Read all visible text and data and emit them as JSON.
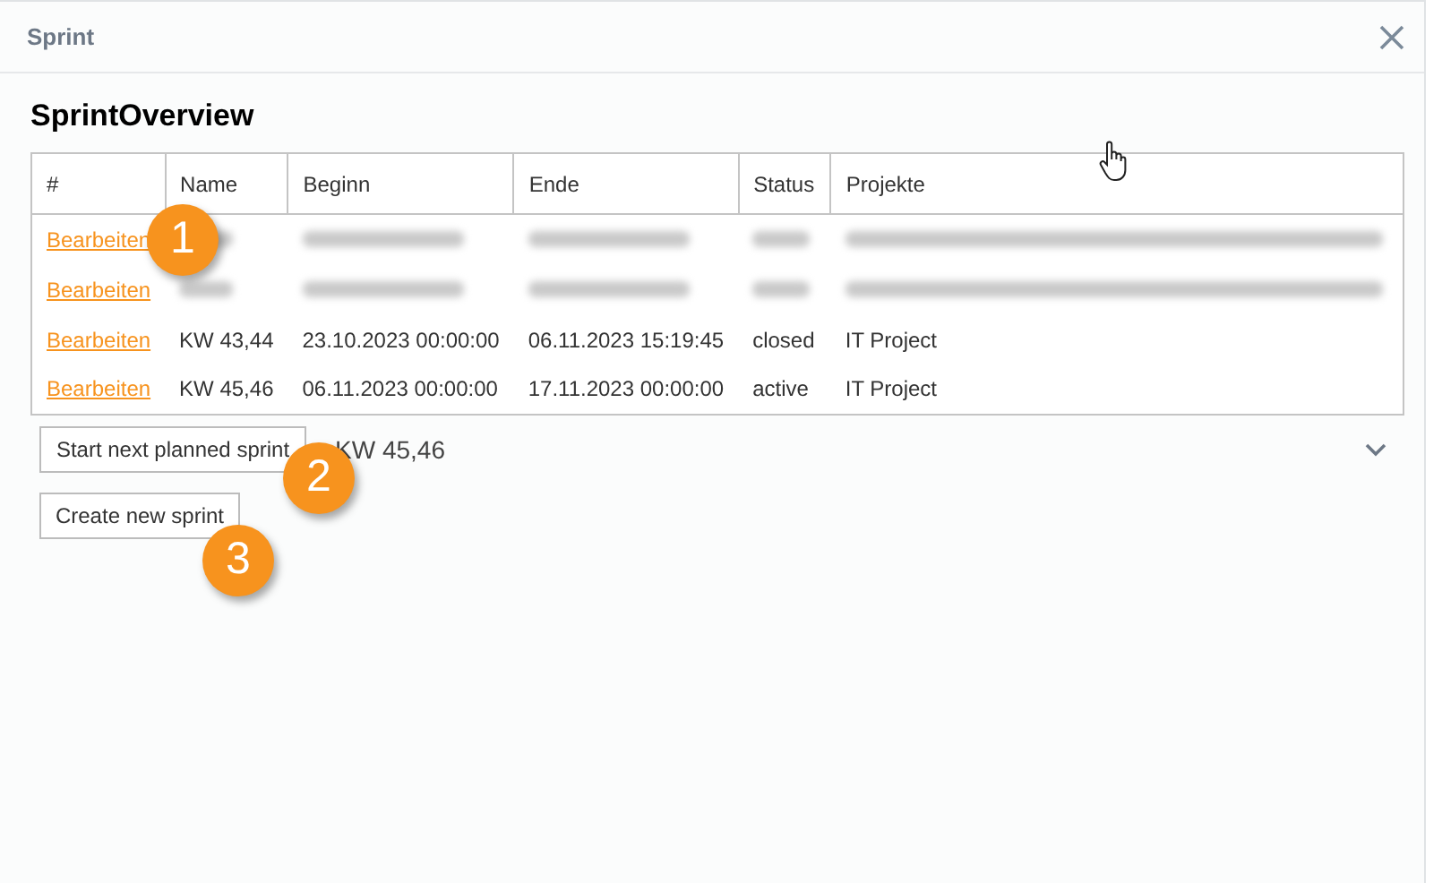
{
  "window": {
    "title": "Sprint"
  },
  "heading": "SprintOverview",
  "table": {
    "columns": [
      "#",
      "Name",
      "Beginn",
      "Ende",
      "Status",
      "Projekte"
    ],
    "rows": [
      {
        "link": "Bearbeiten",
        "blurred": true
      },
      {
        "link": "Bearbeiten",
        "blurred": true
      },
      {
        "link": "Bearbeiten",
        "blurred": false,
        "cells": [
          "KW 43,44",
          "23.10.2023 00:00:00",
          "06.11.2023 15:19:45",
          "closed",
          "IT Project"
        ]
      },
      {
        "link": "Bearbeiten",
        "blurred": false,
        "cells": [
          "KW 45,46",
          "06.11.2023 00:00:00",
          "17.11.2023 00:00:00",
          "active",
          "IT Project"
        ]
      }
    ]
  },
  "start_button": "Start next planned sprint",
  "sprint_select": {
    "value": "KW 45,46"
  },
  "create_button": "Create new sprint",
  "callouts": [
    "1",
    "2",
    "3"
  ]
}
